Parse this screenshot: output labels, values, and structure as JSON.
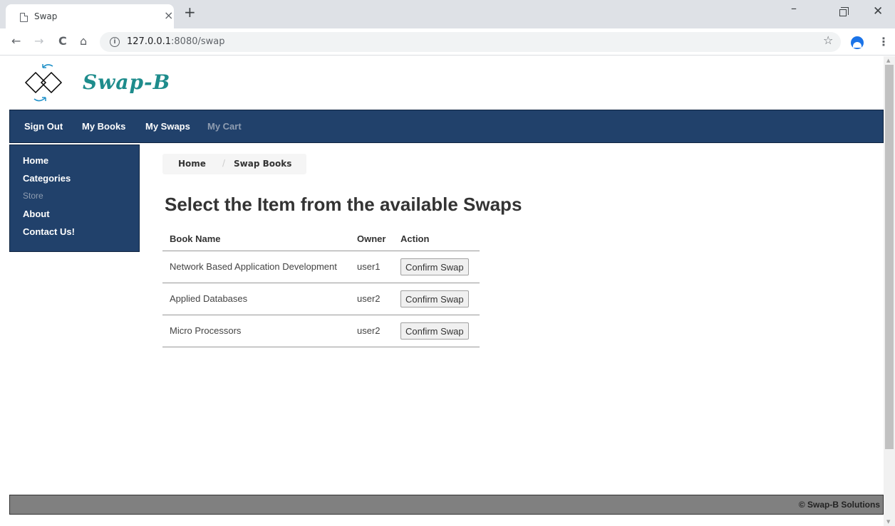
{
  "browser": {
    "tab_title": "Swap",
    "tab_close": "×",
    "new_tab": "+",
    "url_host": "127.0.0.1",
    "url_rest": ":8080/swap",
    "info_glyph": "i",
    "back_glyph": "←",
    "forward_glyph": "→",
    "reload_glyph": "C",
    "home_glyph": "⌂",
    "star_glyph": "☆",
    "menu_glyph": "⋮",
    "minimize_glyph": "–",
    "close_glyph": "✕"
  },
  "site": {
    "logo_text": "Swap-B",
    "logo_color": "#1e8c8c",
    "nav_color": "#21416b"
  },
  "topnav": {
    "items": [
      {
        "label": "Sign Out"
      },
      {
        "label": "My Books"
      },
      {
        "label": "My Swaps"
      },
      {
        "label": "My Cart"
      }
    ]
  },
  "sidebar": {
    "items": [
      {
        "label": "Home"
      },
      {
        "label": "Categories"
      },
      {
        "label": "Store"
      },
      {
        "label": "About"
      },
      {
        "label": "Contact Us!"
      }
    ]
  },
  "breadcrumb": {
    "home": "Home",
    "separator": "/",
    "current": "Swap Books"
  },
  "page_title": "Select the Item from the available Swaps",
  "table": {
    "headers": [
      "Book Name",
      "Owner",
      "Action"
    ],
    "rows": [
      {
        "book": "Network Based Application Development",
        "owner": "user1",
        "action": "Confirm Swap"
      },
      {
        "book": "Applied Databases",
        "owner": "user2",
        "action": "Confirm Swap"
      },
      {
        "book": "Micro Processors",
        "owner": "user2",
        "action": "Confirm Swap"
      }
    ]
  },
  "footer": {
    "text": "© Swap-B Solutions"
  }
}
